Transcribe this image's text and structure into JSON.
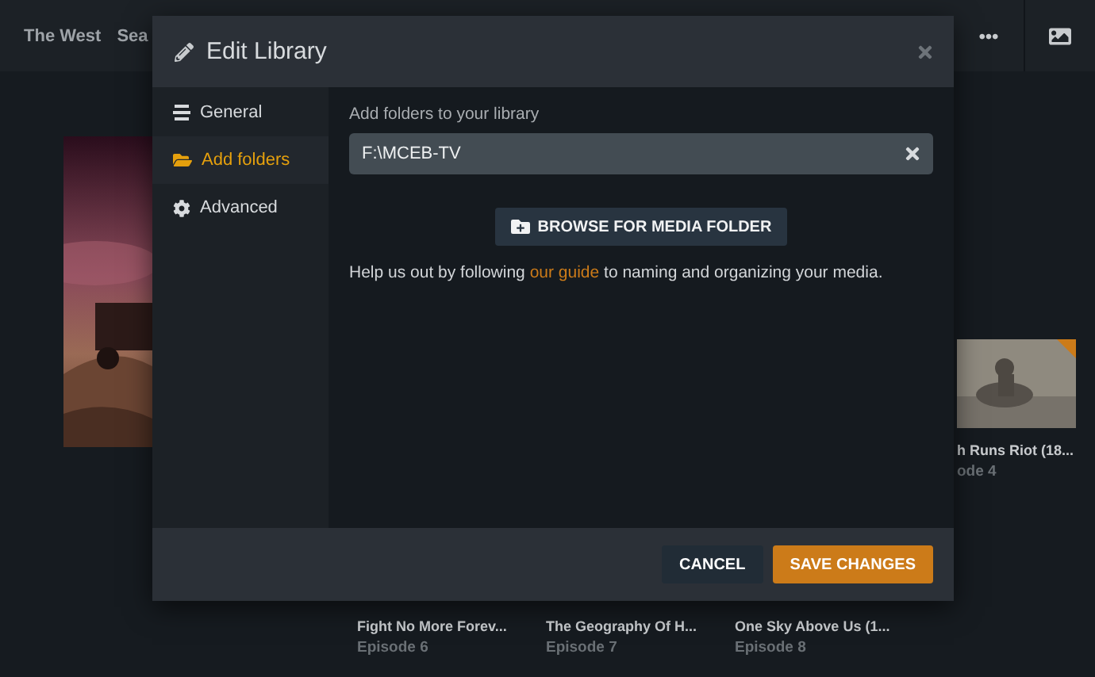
{
  "top_bar": {
    "nav_items": [
      "The West",
      "Sea"
    ]
  },
  "background": {
    "side_card": {
      "title": "h Runs Riot (18...",
      "subtitle": "ode 4"
    },
    "episodes": [
      {
        "title": "Fight No More Forev...",
        "subtitle": "Episode 6"
      },
      {
        "title": "The Geography Of H...",
        "subtitle": "Episode 7"
      },
      {
        "title": "One Sky Above Us (1...",
        "subtitle": "Episode 8"
      }
    ]
  },
  "dialog": {
    "title": "Edit Library",
    "sidebar": [
      {
        "label": "General",
        "selected": false
      },
      {
        "label": "Add folders",
        "selected": true
      },
      {
        "label": "Advanced",
        "selected": false
      }
    ],
    "field": {
      "label": "Add folders to your library",
      "value": "F:\\MCEB-TV"
    },
    "browse_button": "BROWSE FOR MEDIA FOLDER",
    "help": {
      "before": "Help us out by following",
      "link": "our guide",
      "after": "to naming and organizing your media."
    },
    "buttons": [
      {
        "label": "CANCEL",
        "kind": "secondary"
      },
      {
        "label": "SAVE CHANGES",
        "kind": "primary"
      }
    ]
  }
}
